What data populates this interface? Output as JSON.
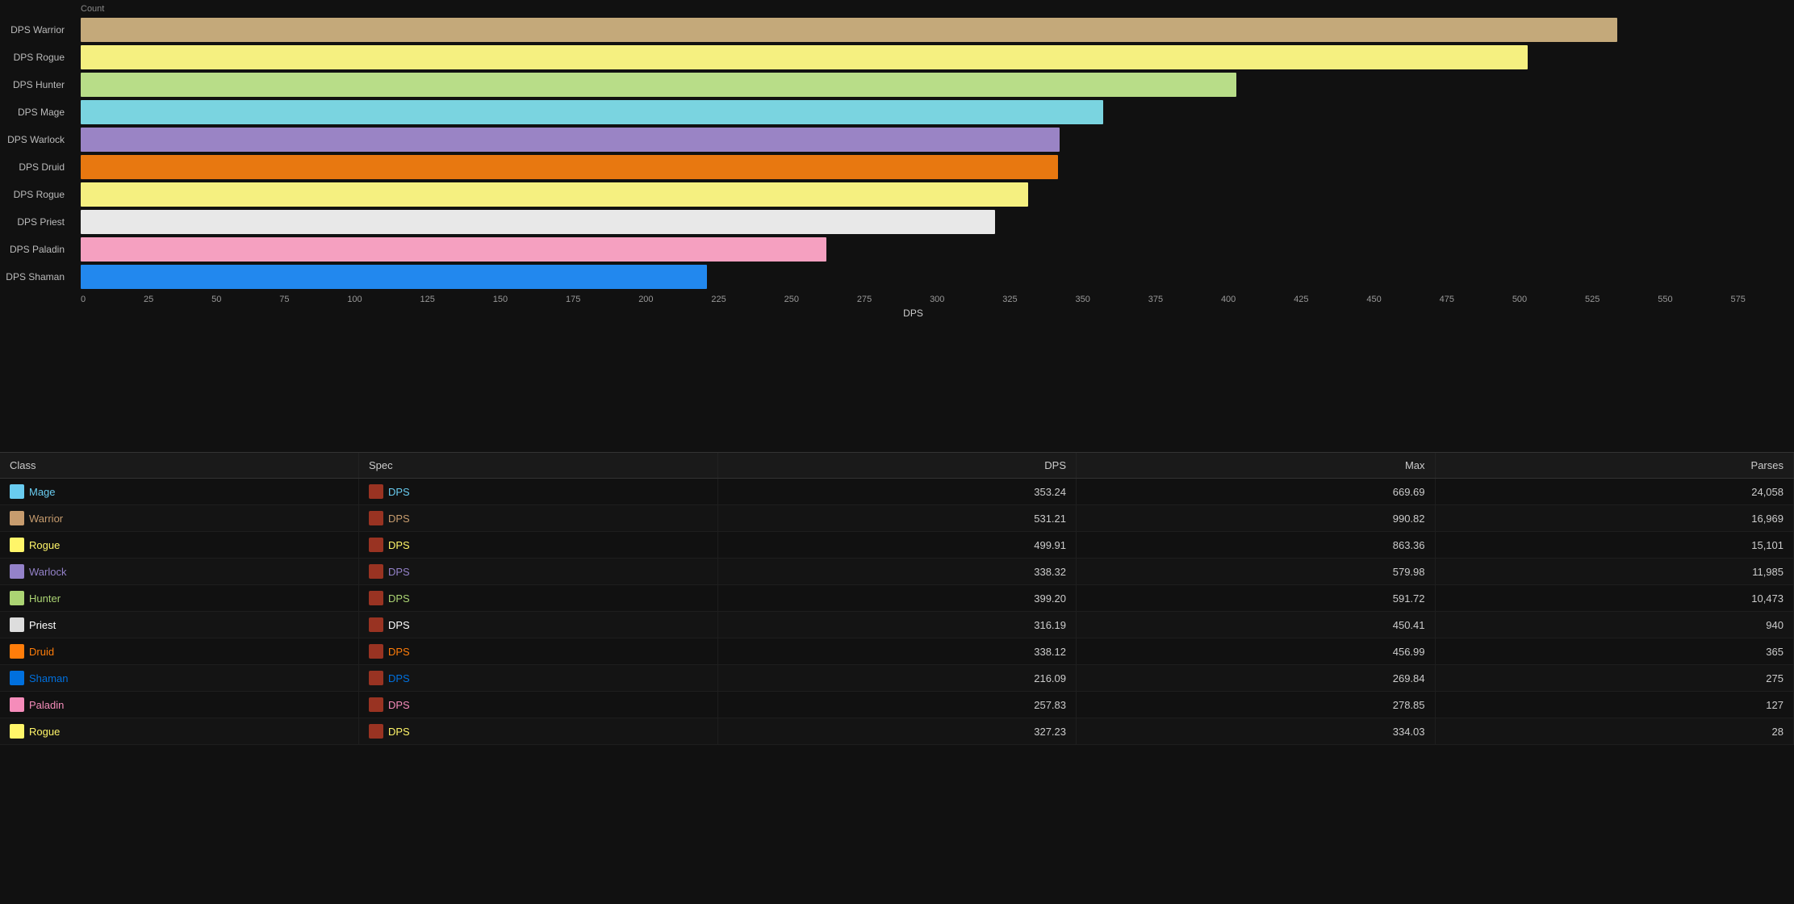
{
  "chart": {
    "title": "Count",
    "x_axis_title": "DPS",
    "x_labels": [
      "0",
      "25",
      "50",
      "75",
      "100",
      "125",
      "150",
      "175",
      "200",
      "225",
      "250",
      "275",
      "300",
      "325",
      "350",
      "375",
      "400",
      "425",
      "450",
      "475",
      "500",
      "525",
      "550",
      "575"
    ],
    "max_value": 575,
    "bars": [
      {
        "label": "DPS Warrior",
        "value": 531,
        "color": "#C4A97A",
        "pct": 92.3
      },
      {
        "label": "DPS Rogue",
        "value": 500,
        "color": "#F5F080",
        "pct": 86.9
      },
      {
        "label": "DPS Hunter",
        "value": 399,
        "color": "#B8DD88",
        "pct": 69.4
      },
      {
        "label": "DPS Mage",
        "value": 353,
        "color": "#7AD4E0",
        "pct": 61.4
      },
      {
        "label": "DPS Warlock",
        "value": 338,
        "color": "#9A84C5",
        "pct": 58.8
      },
      {
        "label": "DPS Druid",
        "value": 338,
        "color": "#E87810",
        "pct": 58.7
      },
      {
        "label": "DPS Rogue",
        "value": 327,
        "color": "#F5F080",
        "pct": 56.9
      },
      {
        "label": "DPS Priest",
        "value": 316,
        "color": "#E8E8E8",
        "pct": 54.9
      },
      {
        "label": "DPS Paladin",
        "value": 258,
        "color": "#F5A0C0",
        "pct": 44.8
      },
      {
        "label": "DPS Shaman",
        "value": 216,
        "color": "#2288EE",
        "pct": 37.6
      }
    ]
  },
  "table": {
    "headers": [
      "Class",
      "Spec",
      "DPS",
      "Max",
      "Parses"
    ],
    "rows": [
      {
        "class": "Mage",
        "class_color": "mage-color",
        "spec": "DPS",
        "dps": "353.24",
        "max": "669.69",
        "parses": "24,058"
      },
      {
        "class": "Warrior",
        "class_color": "warrior-color",
        "spec": "DPS",
        "dps": "531.21",
        "max": "990.82",
        "parses": "16,969"
      },
      {
        "class": "Rogue",
        "class_color": "rogue-color",
        "spec": "DPS",
        "dps": "499.91",
        "max": "863.36",
        "parses": "15,101"
      },
      {
        "class": "Warlock",
        "class_color": "warlock-color",
        "spec": "DPS",
        "dps": "338.32",
        "max": "579.98",
        "parses": "11,985"
      },
      {
        "class": "Hunter",
        "class_color": "hunter-color",
        "spec": "DPS",
        "dps": "399.20",
        "max": "591.72",
        "parses": "10,473"
      },
      {
        "class": "Priest",
        "class_color": "priest-color",
        "spec": "DPS",
        "dps": "316.19",
        "max": "450.41",
        "parses": "940"
      },
      {
        "class": "Druid",
        "class_color": "druid-color",
        "spec": "DPS",
        "dps": "338.12",
        "max": "456.99",
        "parses": "365"
      },
      {
        "class": "Shaman",
        "class_color": "shaman-color",
        "spec": "DPS",
        "dps": "216.09",
        "max": "269.84",
        "parses": "275"
      },
      {
        "class": "Paladin",
        "class_color": "paladin-color",
        "spec": "DPS",
        "dps": "257.83",
        "max": "278.85",
        "parses": "127"
      },
      {
        "class": "Rogue",
        "class_color": "rogue-color",
        "spec": "DPS",
        "dps": "327.23",
        "max": "334.03",
        "parses": "28"
      }
    ]
  }
}
